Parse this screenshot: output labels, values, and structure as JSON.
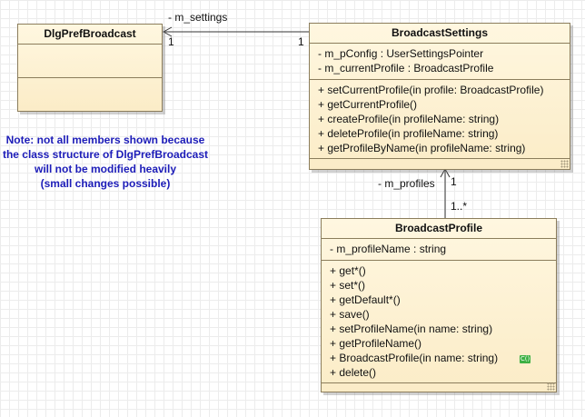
{
  "classes": {
    "dlg_pref_broadcast": {
      "name": "DlgPrefBroadcast"
    },
    "broadcast_settings": {
      "name": "BroadcastSettings",
      "attributes": [
        "- m_pConfig : UserSettingsPointer",
        "- m_currentProfile : BroadcastProfile"
      ],
      "operations": [
        "+ setCurrentProfile(in profile: BroadcastProfile)",
        "+ getCurrentProfile()",
        "+ createProfile(in profileName: string)",
        "+ deleteProfile(in profileName: string)",
        "+ getProfileByName(in profileName: string)"
      ]
    },
    "broadcast_profile": {
      "name": "BroadcastProfile",
      "attributes": [
        "- m_profileName : string"
      ],
      "operations": [
        "+ get*()",
        "+ set*()",
        "+ getDefault*()",
        "+ save()",
        "+ setProfileName(in name: string)",
        "+ getProfileName()",
        "+ BroadcastProfile(in name: string)",
        "+ delete()"
      ],
      "constructor_icon": "C()"
    }
  },
  "associations": {
    "settings": {
      "role": "- m_settings",
      "source_multiplicity": "1",
      "target_multiplicity": "1"
    },
    "profiles": {
      "role": "- m_profiles",
      "source_multiplicity": "1",
      "target_multiplicity": "1..*"
    }
  },
  "note": {
    "lines": [
      "Note: not all members shown because",
      "the class structure of DlgPrefBroadcast",
      "will not be modified heavily",
      "(small changes possible)"
    ],
    "color": "#1c1cb8"
  },
  "colors": {
    "class_fill_top": "#fff7e0",
    "class_fill_bottom": "#fbecc7",
    "class_border": "#8b7d5c",
    "grid": "#ececec"
  }
}
